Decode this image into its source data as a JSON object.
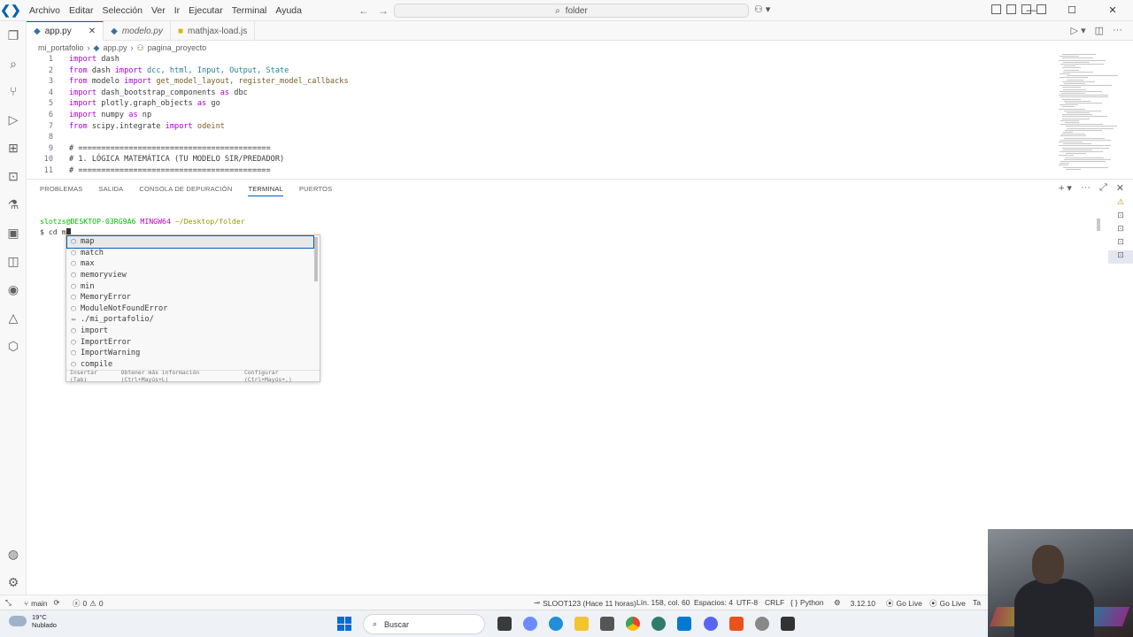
{
  "titlebar": {
    "menu": [
      "Archivo",
      "Editar",
      "Selección",
      "Ver",
      "Ir",
      "Ejecutar",
      "Terminal",
      "Ayuda"
    ],
    "search_text": "folder",
    "window_controls": [
      "—",
      "☐",
      "✕"
    ]
  },
  "tabs": [
    {
      "label": "app.py",
      "type": "py",
      "active": true
    },
    {
      "label": "modelo.py",
      "type": "py",
      "active": false
    },
    {
      "label": "mathjax-load.js",
      "type": "js",
      "active": false
    }
  ],
  "breadcrumb": [
    "mi_portafolio",
    "app.py",
    "pagina_proyecto"
  ],
  "editor": {
    "lines": [
      {
        "n": "1"
      },
      {
        "n": "2"
      },
      {
        "n": "3"
      },
      {
        "n": "4"
      },
      {
        "n": "5"
      },
      {
        "n": "6"
      },
      {
        "n": "7"
      },
      {
        "n": "8"
      },
      {
        "n": "9"
      },
      {
        "n": "10"
      },
      {
        "n": "11"
      }
    ],
    "code": {
      "l1_import": "import",
      "l1_rest": " dash",
      "l2_from": "from",
      "l2_mod": " dash ",
      "l2_import": "import",
      "l2_rest": " dcc, html, Input, Output, State",
      "l3_from": "from",
      "l3_mod": " modelo ",
      "l3_import": "import",
      "l3_rest": " get_model_layout, register_model_callbacks",
      "l4_import": "import",
      "l4_mod": " dash_bootstrap_components ",
      "l4_as": "as",
      "l4_rest": " dbc",
      "l5_import": "import",
      "l5_mod": " plotly.graph_objects ",
      "l5_as": "as",
      "l5_rest": " go",
      "l6_import": "import",
      "l6_mod": " numpy ",
      "l6_as": "as",
      "l6_rest": " np",
      "l7_from": "from",
      "l7_mod": " scipy.integrate ",
      "l7_import": "import",
      "l7_rest": " odeint",
      "l9": "# ==========================================",
      "l10": "# 1. LÓGICA MATEMÁTICA (TU MODELO SIR/PREDADOR)",
      "l11": "# =========================================="
    }
  },
  "panel": {
    "tabs": [
      "PROBLEMAS",
      "SALIDA",
      "CONSOLA DE DEPURACIÓN",
      "TERMINAL",
      "PUERTOS"
    ],
    "active_tab": "TERMINAL",
    "prompt_user": "slotzs@DESKTOP-03RG9A6",
    "prompt_shell": "MINGW64",
    "prompt_path": "~/Desktop/folder",
    "command": "$ cd m"
  },
  "suggest": {
    "items": [
      {
        "label": "map",
        "icon": "module-icon"
      },
      {
        "label": "match",
        "icon": "module-icon"
      },
      {
        "label": "max",
        "icon": "module-icon"
      },
      {
        "label": "memoryview",
        "icon": "module-icon"
      },
      {
        "label": "min",
        "icon": "module-icon"
      },
      {
        "label": "MemoryError",
        "icon": "module-icon"
      },
      {
        "label": "ModuleNotFoundError",
        "icon": "module-icon"
      },
      {
        "label": "./mi_portafolio/",
        "icon": "folder-icon"
      },
      {
        "label": "import",
        "icon": "module-icon"
      },
      {
        "label": "ImportError",
        "icon": "module-icon"
      },
      {
        "label": "ImportWarning",
        "icon": "module-icon"
      },
      {
        "label": "compile",
        "icon": "module-icon"
      }
    ],
    "footer_insert": "Insertar (Tab)",
    "footer_more": "Obtener más información (Ctrl+Mayús+L)",
    "footer_config": "Configurar (Ctrl+Mayús+,)"
  },
  "statusbar": {
    "branch": "main",
    "errors": "0",
    "warnings": "0",
    "commit": "SLOOT123 (Hace 11 horas)",
    "position": "Lín. 158, col. 60",
    "spaces": "Espacios: 4",
    "encoding": "UTF-8",
    "eol": "CRLF",
    "language": "Python",
    "python_version": "3.12.10",
    "golive1": "Go Live",
    "golive2": "Go Live",
    "extra": "Ta"
  },
  "taskbar": {
    "temp": "19°C",
    "weather": "Nublado",
    "search": "Buscar"
  },
  "colors": {
    "accent": "#005fb8",
    "keyword": "#af00db",
    "comment": "#008000",
    "terminal_user": "#00bc00",
    "terminal_shell": "#bc05bc",
    "terminal_path": "#949800"
  }
}
